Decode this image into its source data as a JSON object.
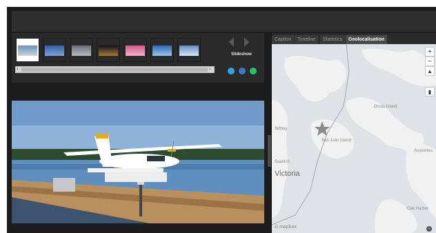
{
  "filmstrip": {
    "slideshow_label": "Slideshow",
    "thumbnails": [
      {
        "id": "1",
        "colors": [
          "#6a8fb8",
          "#c9d4dd"
        ]
      },
      {
        "id": "2",
        "colors": [
          "#2f5fa4",
          "#7aa3d4"
        ]
      },
      {
        "id": "3",
        "colors": [
          "#6a6f76",
          "#b7bcc2"
        ]
      },
      {
        "id": "4",
        "colors": [
          "#10121a",
          "#a87c3a"
        ]
      },
      {
        "id": "5",
        "colors": [
          "#d35a8a",
          "#f1b4cb"
        ]
      },
      {
        "id": "6",
        "colors": [
          "#2a6bb4",
          "#9fc2e8"
        ]
      },
      {
        "id": "7",
        "colors": [
          "#5b8fc8",
          "#d8e7f6"
        ]
      }
    ],
    "controls": [
      "share-icon",
      "print-icon",
      "download-icon"
    ],
    "control_colors": [
      "#2aa9e0",
      "#3b78c9",
      "#25c26a"
    ]
  },
  "tabs": [
    {
      "label": "Caption",
      "active": false
    },
    {
      "label": "Timeline",
      "active": false
    },
    {
      "label": "Statistics",
      "active": false
    },
    {
      "label": "Geolocalisation",
      "active": true
    }
  ],
  "map": {
    "zoom_in": "+",
    "zoom_out": "−",
    "places": [
      {
        "name": "Orcas Island"
      },
      {
        "name": "San Juan Island"
      },
      {
        "name": "Saanich"
      },
      {
        "name": "Victoria"
      },
      {
        "name": "Anacortes"
      },
      {
        "name": "Oak Harbor"
      },
      {
        "name": "Sidney"
      }
    ],
    "attribution": "© mapbox"
  },
  "colors": {
    "accent_share": "#2aa9e0",
    "accent_print": "#3b78c9",
    "accent_download": "#25c26a",
    "map_water": "#dfe2e6",
    "map_land": "#f1f1f1"
  }
}
